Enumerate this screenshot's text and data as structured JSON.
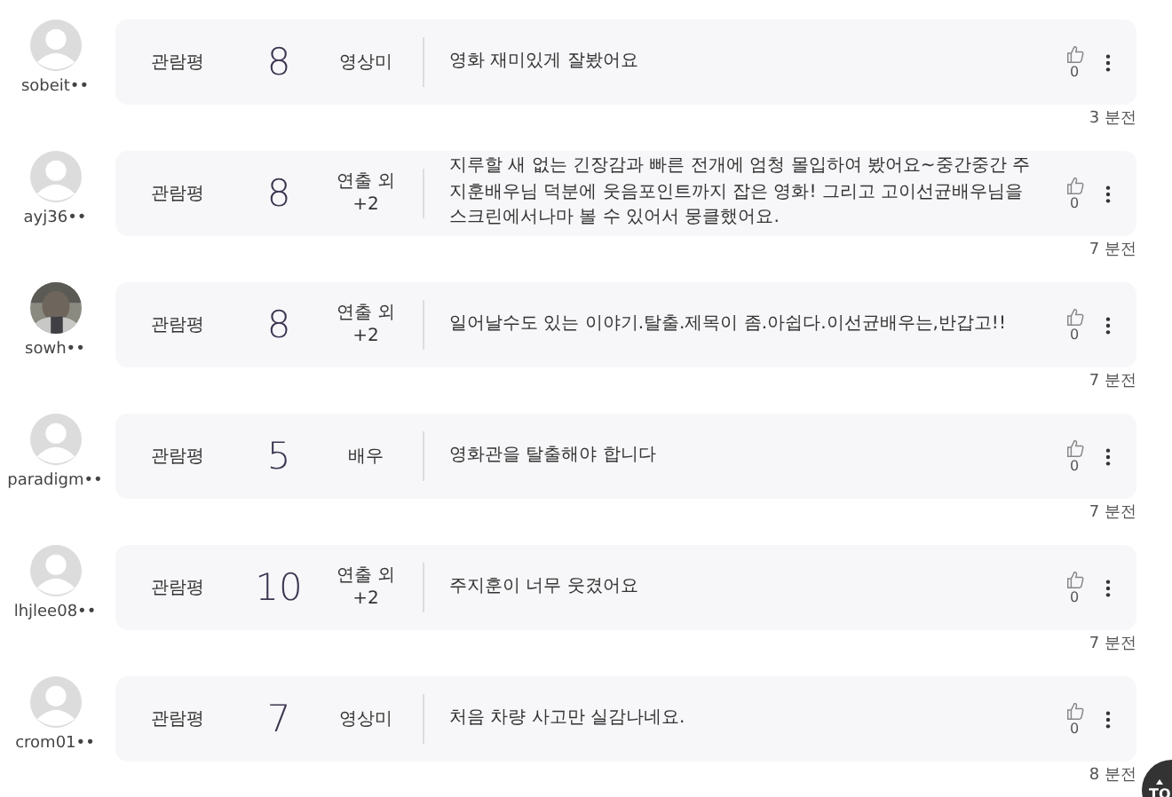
{
  "reviews": [
    {
      "user": "sobeit••",
      "kind": "default",
      "label": "관람평",
      "score": "8",
      "point": "영상미",
      "comment": "영화 재미있게 잘봤어요",
      "likes": "0",
      "time": "3 분전"
    },
    {
      "user": "ayj36••",
      "kind": "default",
      "label": "관람평",
      "score": "8",
      "point": "연출 외",
      "extra": "+2",
      "comment": "지루할 새 없는 긴장감과 빠른 전개에 엄청 몰입하여 봤어요~중간중간 주지훈배우님 덕분에 웃음포인트까지 잡은 영화! 그리고 고이선균배우님을 스크린에서나마 볼 수 있어서 뭉클했어요.",
      "likes": "0",
      "time": "7 분전"
    },
    {
      "user": "sowh••",
      "kind": "picture",
      "label": "관람평",
      "score": "8",
      "point": "연출 외",
      "extra": "+2",
      "comment": "일어날수도 있는 이야기.탈출.제목이 좀.아쉽다.이선균배우는,반갑고!!",
      "likes": "0",
      "time": "7 분전"
    },
    {
      "user": "paradigm••",
      "kind": "default",
      "label": "관람평",
      "score": "5",
      "point": "배우",
      "comment": "영화관을 탈출해야 합니다",
      "likes": "0",
      "time": "7 분전"
    },
    {
      "user": "lhjlee08••",
      "kind": "default",
      "label": "관람평",
      "score": "10",
      "point": "연출 외",
      "extra": "+2",
      "comment": "주지훈이 너무 웃겼어요",
      "likes": "0",
      "time": "7 분전"
    },
    {
      "user": "crom01••",
      "kind": "default",
      "label": "관람평",
      "score": "7",
      "point": "영상미",
      "comment": "처음 차량 사고만 실감나네요.",
      "likes": "0",
      "time": "8 분전"
    }
  ],
  "top_button": {
    "label": "TO"
  }
}
